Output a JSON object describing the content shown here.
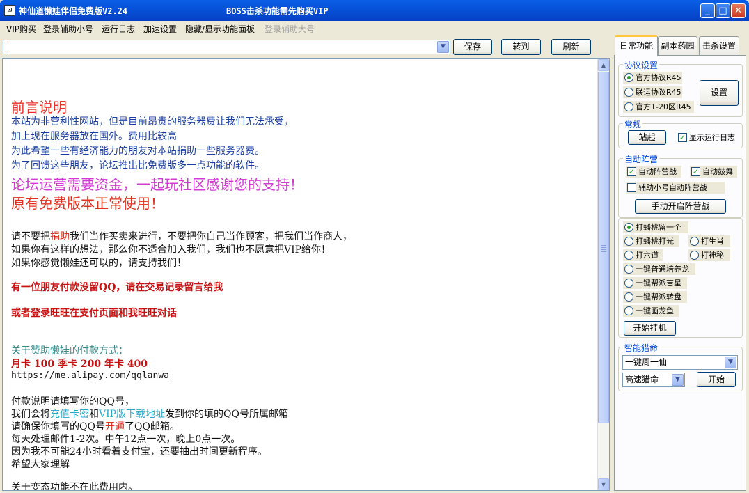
{
  "window": {
    "title": "神仙道懒娃伴侣免费版V2.24",
    "notice": "BOSS击杀功能需先购买VIP",
    "minimize_glyph": "_",
    "maximize_glyph": "□",
    "close_glyph": "✕"
  },
  "menu": [
    "VIP购买",
    "登录辅助小号",
    "运行日志",
    "加速设置",
    "隐藏/显示功能面板",
    "登录辅助大号"
  ],
  "toolbar": {
    "url_value": "",
    "save": "保存",
    "goto": "转到",
    "refresh": "刷新"
  },
  "content": {
    "lines": [
      "前言说明",
      "本站为非营利性网站，但是目前昂贵的服务器费让我们无法承受，",
      "加上现在服务器放在国外。费用比较高",
      "为此希望一些有经济能力的朋友对本站捐助一些服务器费。",
      "为了回馈这些朋友，论坛推出比免费版多一点功能的软件。",
      "论坛运营需要资金，一起玩社区感谢您的支持！",
      "原有免费版本正常使用！",
      "请不要把",
      "捐助",
      "我们当作买卖来进行，不要把你自己当作顾客，把我们当作商人，",
      "如果你有这样的想法，那么你不适合加入我们，我们也不愿意把VIP给你！",
      "如果你感觉懒娃还可以的，请支持我们！",
      "有一位朋友付款没留QQ，请在交易记录留言给我",
      "或者登录旺旺在支付页面和我旺旺对话",
      "关于赞助懒娃的付款方式：",
      "月卡 100 季卡 200  年卡 400",
      "https://me.alipay.com/qqlanwa",
      "付款说明请填写你的QQ号，",
      "我们会将",
      "充值卡密",
      "和",
      "VIP版下载地址",
      "发到你的填的QQ号所属邮箱",
      "请确保你填写的QQ号",
      "开通",
      "了QQ邮箱。",
      "每天处理邮件1-2次。中午12点一次，晚上0点一次。",
      "因为我不可能24小时看着支付宝，还要抽出时间更新程序。",
      "希望大家理解",
      "关于变态功能不在此费用内。"
    ]
  },
  "tabs": [
    "日常功能",
    "副本药园",
    "击杀设置"
  ],
  "protocol": {
    "label": "协议设置",
    "options": [
      "官方协议R45",
      "联运协议R45",
      "官方1-20区R45"
    ],
    "selected": 0,
    "set_button": "设置"
  },
  "general": {
    "label": "常规",
    "stand_button": "站起",
    "show_log": "显示运行日志",
    "show_log_checked": true
  },
  "auto_camp": {
    "label": "自动阵营",
    "auto_camp_battle": "自动阵营战",
    "auto_drum": "自动鼓舞",
    "alt_auto_camp": "辅助小号自动阵营战",
    "checked": [
      true,
      true,
      false
    ],
    "manual_button": "手动开启阵营战"
  },
  "actions": {
    "options": [
      "打蟠桃留一个",
      "打蟠桃打光",
      "打生肖",
      "打六道",
      "打神秘",
      "一键普通培养龙",
      "一键帮派吉星",
      "一键帮派转盘",
      "一键画龙鱼"
    ],
    "selected": 0,
    "start_button": "开始挂机"
  },
  "fate": {
    "label": "智能猎命",
    "mode": "一键周一仙",
    "speed": "高速猎命",
    "start_button": "开始"
  }
}
